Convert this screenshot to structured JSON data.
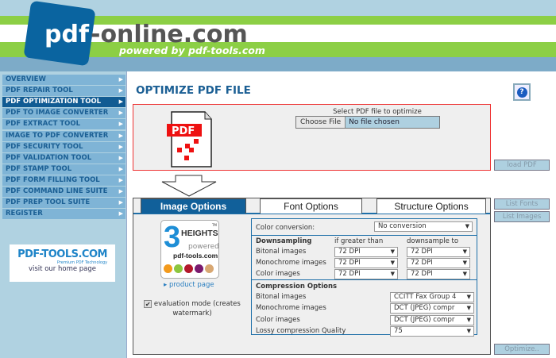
{
  "header": {
    "logo_left": "pdf",
    "logo_right": "-online.com",
    "tagline": "powered by pdf-tools.com",
    "colors": {
      "brand_blue": "#0a64a0",
      "green": "#8ccf45"
    }
  },
  "sidebar": {
    "items": [
      {
        "label": "OVERVIEW",
        "active": false
      },
      {
        "label": "PDF REPAIR TOOL",
        "active": false
      },
      {
        "label": "PDF OPTIMIZATION TOOL",
        "active": true
      },
      {
        "label": "PDF TO IMAGE CONVERTER",
        "active": false
      },
      {
        "label": "PDF EXTRACT TOOL",
        "active": false
      },
      {
        "label": "IMAGE TO PDF CONVERTER",
        "active": false
      },
      {
        "label": "PDF SECURITY TOOL",
        "active": false
      },
      {
        "label": "PDF VALIDATION TOOL",
        "active": false
      },
      {
        "label": "PDF STAMP TOOL",
        "active": false
      },
      {
        "label": "PDF FORM FILLING TOOL",
        "active": false
      },
      {
        "label": "PDF COMMAND LINE SUITE",
        "active": false
      },
      {
        "label": "PDF PREP TOOL SUITE",
        "active": false
      },
      {
        "label": "REGISTER",
        "active": false
      }
    ],
    "ad": {
      "logo": "PDF-TOOLS.COM",
      "logo_sub": "Premium PDF Technology",
      "link": "visit our home page"
    }
  },
  "main": {
    "title": "OPTIMIZE PDF FILE",
    "help_icon": "question-icon",
    "upload": {
      "pdf_icon_label": "PDF",
      "label": "Select PDF file to optimize",
      "button": "Choose File",
      "value": "No file chosen"
    },
    "buttons": {
      "load": "load PDF",
      "list_fonts": "List Fonts",
      "list_images": "List Images",
      "optimize": "Optimize.."
    },
    "tabs": [
      {
        "label": "Image Options",
        "active": true
      },
      {
        "label": "Font Options",
        "active": false
      },
      {
        "label": "Structure Options",
        "active": false
      }
    ],
    "product": {
      "logo_num": "3",
      "logo_word": "HEIGHTS",
      "logo_tm": "TM",
      "logo_powered": "powered",
      "logo_site": "pdf-tools.com",
      "dots": [
        "#f39a1c",
        "#8cc63e",
        "#b3182b",
        "#7a1a6e",
        "#d8a772"
      ],
      "link": "product page"
    },
    "evaluation": {
      "label": "evaluation mode (creates watermark)",
      "checked": true
    },
    "options": {
      "color_conversion": {
        "label": "Color conversion:",
        "value": "No conversion"
      },
      "downsampling": {
        "title": "Downsampling",
        "col1": "if greater than",
        "col2": "downsample to",
        "rows": [
          {
            "label": "Bitonal images",
            "if": "72 DPI",
            "to": "72 DPI"
          },
          {
            "label": "Monochrome images",
            "if": "72 DPI",
            "to": "72 DPI"
          },
          {
            "label": "Color images",
            "if": "72 DPI",
            "to": "72 DPI"
          }
        ]
      },
      "compression": {
        "title": "Compression Options",
        "rows": [
          {
            "label": "Bitonal images",
            "value": "CCITT Fax Group 4"
          },
          {
            "label": "Monochrome images",
            "value": "DCT (JPEG) compr"
          },
          {
            "label": "Color images",
            "value": "DCT (JPEG) compr"
          },
          {
            "label": "Lossy compression Quality",
            "value": "75"
          }
        ]
      }
    }
  }
}
